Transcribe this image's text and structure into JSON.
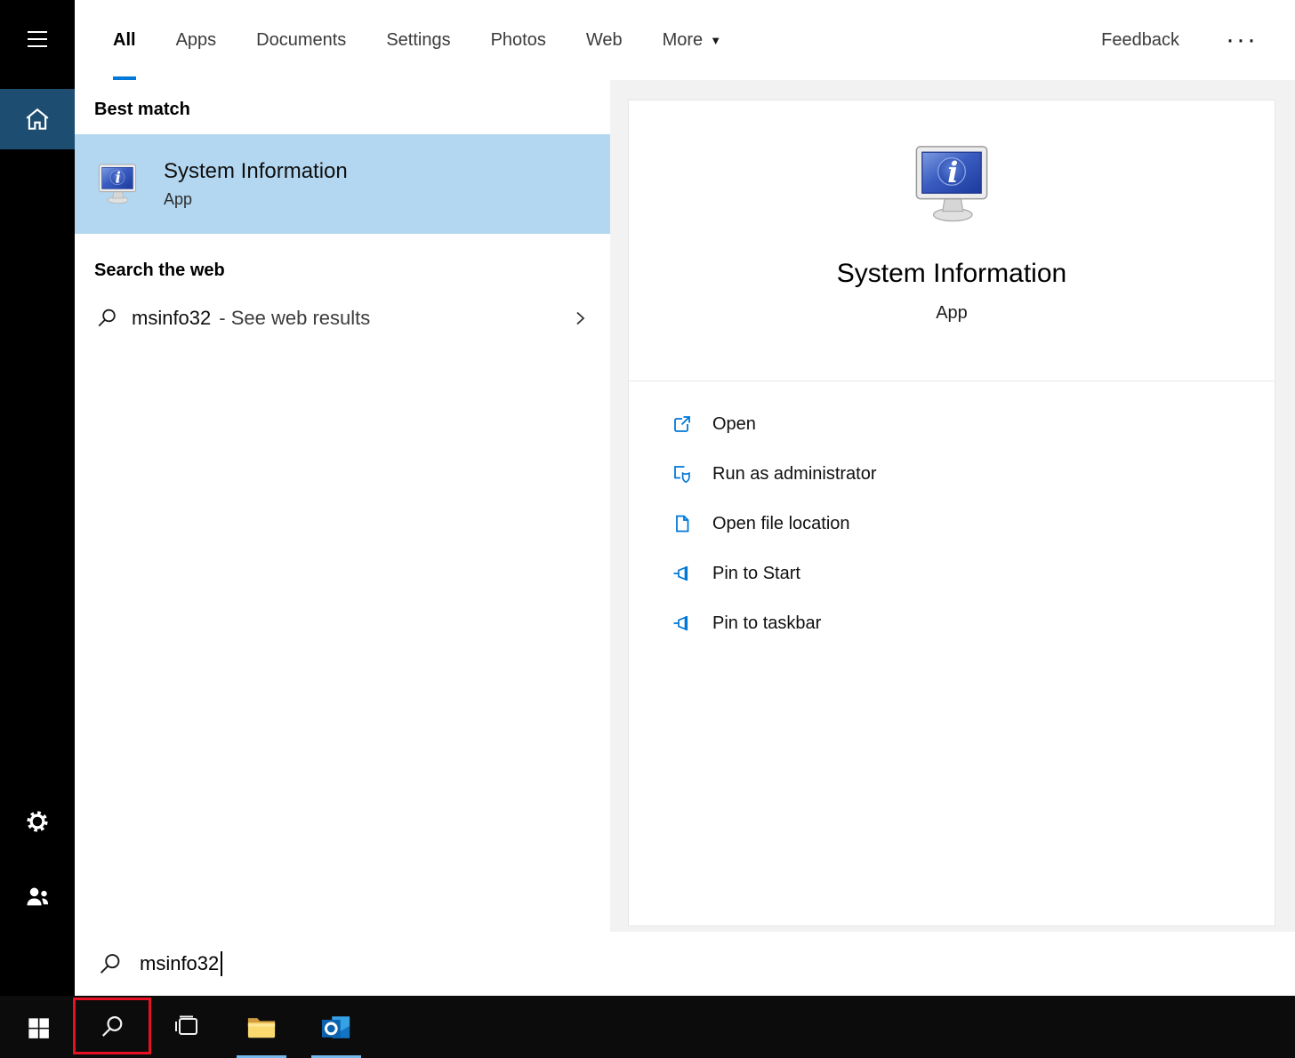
{
  "colors": {
    "accent": "#0078d7",
    "selection_bg": "#b3d7f0",
    "sidebar_home_bg": "#1d4d71",
    "annotation_red": "#e81123",
    "running_indicator": "#76b9ed"
  },
  "topbar": {
    "tabs": [
      "All",
      "Apps",
      "Documents",
      "Settings",
      "Photos",
      "Web",
      "More"
    ],
    "feedback": "Feedback",
    "overflow": "···"
  },
  "results": {
    "best_match_header": "Best match",
    "best_match": {
      "title": "System Information",
      "subtitle": "App"
    },
    "search_web_header": "Search the web",
    "web_result": {
      "query": "msinfo32",
      "suffix": "- See web results"
    }
  },
  "preview": {
    "title": "System Information",
    "subtitle": "App",
    "actions": [
      {
        "label": "Open",
        "icon": "open-icon"
      },
      {
        "label": "Run as administrator",
        "icon": "admin-shield-icon"
      },
      {
        "label": "Open file location",
        "icon": "file-location-icon"
      },
      {
        "label": "Pin to Start",
        "icon": "pin-icon"
      },
      {
        "label": "Pin to taskbar",
        "icon": "pin-icon"
      }
    ]
  },
  "search_box": {
    "value": "msinfo32"
  },
  "taskbar": {
    "buttons": [
      "start",
      "search",
      "task-view",
      "file-explorer",
      "outlook"
    ]
  }
}
